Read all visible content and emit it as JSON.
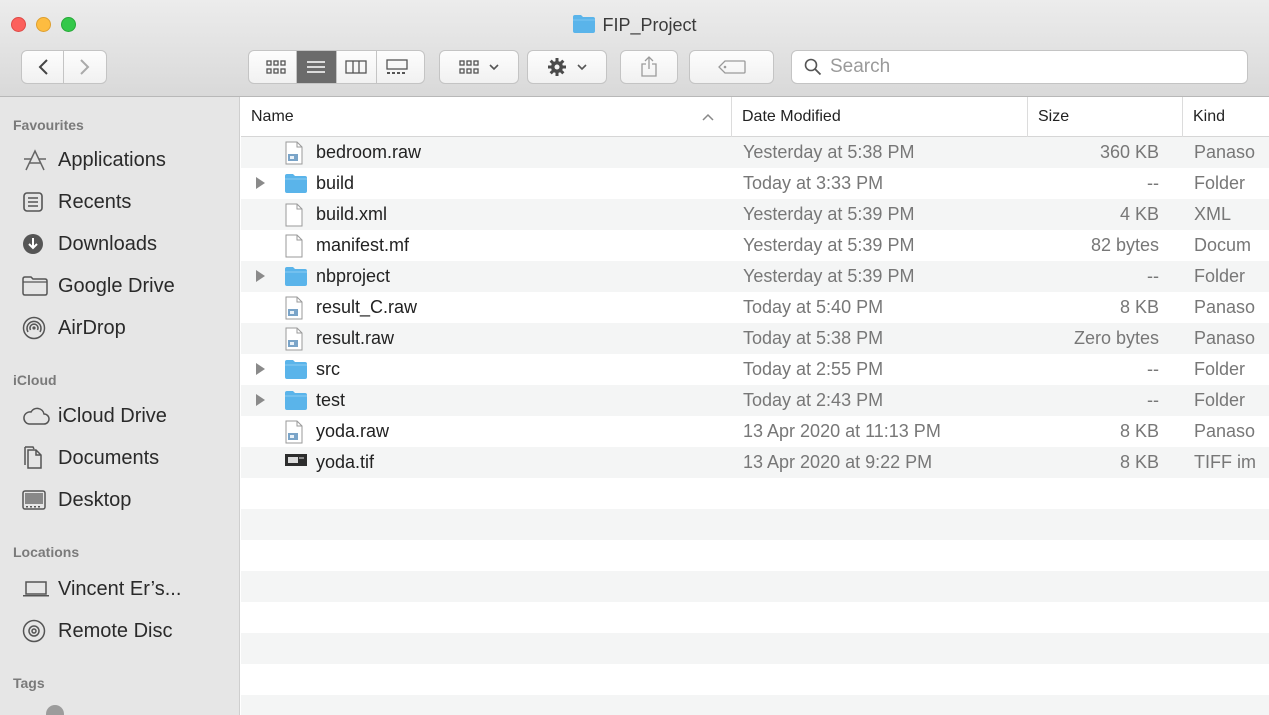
{
  "window": {
    "title": "FIP_Project"
  },
  "toolbar": {
    "view_icons": [
      "icon-view-icon",
      "list-view-icon",
      "column-view-icon",
      "gallery-view-icon"
    ],
    "group_icon": "group-grid-icon",
    "action_icon": "gear-icon",
    "share_icon": "share-icon",
    "tag_icon": "tag-icon"
  },
  "search": {
    "placeholder": "Search"
  },
  "sidebar": {
    "sections": {
      "favourites": "Favourites",
      "icloud": "iCloud",
      "locations": "Locations",
      "tags": "Tags"
    },
    "favourites": [
      {
        "label": "Applications",
        "icon": "applications-icon"
      },
      {
        "label": "Recents",
        "icon": "recents-icon"
      },
      {
        "label": "Downloads",
        "icon": "downloads-icon"
      },
      {
        "label": "Google Drive",
        "icon": "folder-icon"
      },
      {
        "label": "AirDrop",
        "icon": "airdrop-icon"
      }
    ],
    "icloud": [
      {
        "label": "iCloud Drive",
        "icon": "cloud-icon"
      },
      {
        "label": "Documents",
        "icon": "documents-icon"
      },
      {
        "label": "Desktop",
        "icon": "desktop-icon"
      }
    ],
    "locations": [
      {
        "label": "Vincent Er’s...",
        "icon": "laptop-icon"
      },
      {
        "label": "Remote Disc",
        "icon": "disc-icon"
      }
    ]
  },
  "columns": {
    "name": "Name",
    "date": "Date Modified",
    "size": "Size",
    "kind": "Kind"
  },
  "files": [
    {
      "name": "bedroom.raw",
      "date": "Yesterday at 5:38 PM",
      "size": "360 KB",
      "kind": "Panaso",
      "type": "raw",
      "folder": false
    },
    {
      "name": "build",
      "date": "Today at 3:33 PM",
      "size": "--",
      "kind": "Folder",
      "type": "folder",
      "folder": true
    },
    {
      "name": "build.xml",
      "date": "Yesterday at 5:39 PM",
      "size": "4 KB",
      "kind": "XML",
      "type": "doc",
      "folder": false
    },
    {
      "name": "manifest.mf",
      "date": "Yesterday at 5:39 PM",
      "size": "82 bytes",
      "kind": "Docum",
      "type": "doc",
      "folder": false
    },
    {
      "name": "nbproject",
      "date": "Yesterday at 5:39 PM",
      "size": "--",
      "kind": "Folder",
      "type": "folder",
      "folder": true
    },
    {
      "name": "result_C.raw",
      "date": "Today at 5:40 PM",
      "size": "8 KB",
      "kind": "Panaso",
      "type": "raw",
      "folder": false
    },
    {
      "name": "result.raw",
      "date": "Today at 5:38 PM",
      "size": "Zero bytes",
      "kind": "Panaso",
      "type": "raw",
      "folder": false
    },
    {
      "name": "src",
      "date": "Today at 2:55 PM",
      "size": "--",
      "kind": "Folder",
      "type": "folder",
      "folder": true
    },
    {
      "name": "test",
      "date": "Today at 2:43 PM",
      "size": "--",
      "kind": "Folder",
      "type": "folder",
      "folder": true
    },
    {
      "name": "yoda.raw",
      "date": "13 Apr 2020 at 11:13 PM",
      "size": "8 KB",
      "kind": "Panaso",
      "type": "raw",
      "folder": false
    },
    {
      "name": "yoda.tif",
      "date": "13 Apr 2020 at 9:22 PM",
      "size": "8 KB",
      "kind": "TIFF im",
      "type": "tif",
      "folder": false
    }
  ],
  "colors": {
    "folder": "#5ab4ea",
    "sidebar_bg": "#e6e6e6"
  }
}
